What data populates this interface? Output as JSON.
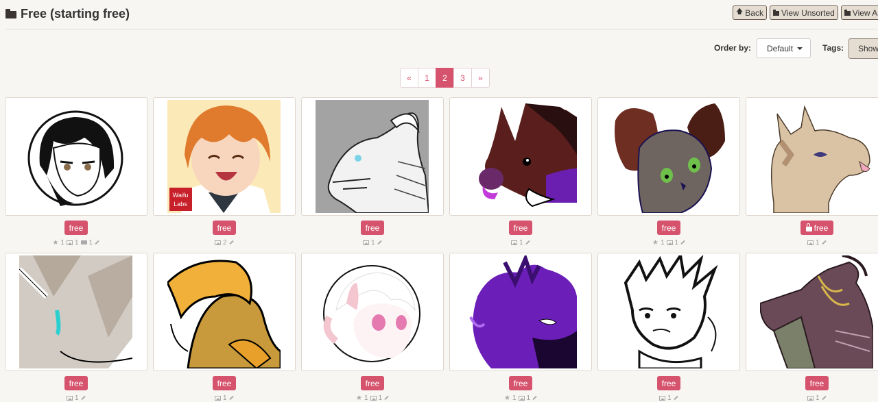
{
  "header": {
    "title": "Free (starting free)",
    "buttons": {
      "back": "Back",
      "view_unsorted": "View Unsorted",
      "view_all": "View A"
    }
  },
  "controls": {
    "order_label": "Order by:",
    "order_value": "Default",
    "tags_label": "Tags:",
    "show_label": "Show"
  },
  "pagination": {
    "prev": "«",
    "pages": [
      "1",
      "2",
      "3"
    ],
    "active": "2",
    "next": "»"
  },
  "cards": [
    {
      "tag": "free",
      "locked": false,
      "stats": [
        {
          "icon": "star-icon",
          "count": "1"
        },
        {
          "icon": "image-icon",
          "count": "1"
        },
        {
          "icon": "comment-icon",
          "count": "1"
        }
      ]
    },
    {
      "tag": "free",
      "locked": false,
      "stats": [
        {
          "icon": "image-icon",
          "count": "2"
        }
      ]
    },
    {
      "tag": "free",
      "locked": false,
      "stats": [
        {
          "icon": "image-icon",
          "count": "1"
        }
      ]
    },
    {
      "tag": "free",
      "locked": false,
      "stats": [
        {
          "icon": "image-icon",
          "count": "1"
        }
      ]
    },
    {
      "tag": "free",
      "locked": false,
      "stats": [
        {
          "icon": "star-icon",
          "count": "1"
        },
        {
          "icon": "image-icon",
          "count": "1"
        }
      ]
    },
    {
      "tag": "free",
      "locked": true,
      "stats": [
        {
          "icon": "image-icon",
          "count": "1"
        }
      ]
    },
    {
      "tag": "free",
      "locked": false,
      "stats": [
        {
          "icon": "image-icon",
          "count": "1"
        }
      ]
    },
    {
      "tag": "free",
      "locked": false,
      "stats": [
        {
          "icon": "image-icon",
          "count": "1"
        }
      ]
    },
    {
      "tag": "free",
      "locked": false,
      "stats": [
        {
          "icon": "star-icon",
          "count": "1"
        },
        {
          "icon": "image-icon",
          "count": "1"
        }
      ]
    },
    {
      "tag": "free",
      "locked": false,
      "stats": [
        {
          "icon": "star-icon",
          "count": "1"
        },
        {
          "icon": "image-icon",
          "count": "1"
        }
      ]
    },
    {
      "tag": "free",
      "locked": false,
      "stats": [
        {
          "icon": "image-icon",
          "count": "1"
        }
      ]
    },
    {
      "tag": "free",
      "locked": false,
      "stats": [
        {
          "icon": "image-icon",
          "count": "1"
        }
      ]
    }
  ],
  "thumb_art": [
    {
      "kind": "avatar-circle",
      "bg": "#ffffff",
      "accent": "#111111"
    },
    {
      "kind": "anime-boy",
      "bg": "#fbe9b7",
      "accent": "#e07a2c",
      "logo": "Waifu Labs"
    },
    {
      "kind": "dragon-sketch",
      "bg": "#a3a3a3",
      "accent": "#f2f2f2"
    },
    {
      "kind": "boar",
      "bg": "#ffffff",
      "accent": "#5a1f1c"
    },
    {
      "kind": "bat-cat",
      "bg": "#ffffff",
      "accent": "#6e6460"
    },
    {
      "kind": "llama",
      "bg": "#ffffff",
      "accent": "#d9c3a4"
    },
    {
      "kind": "unicorn",
      "bg": "#ffffff",
      "accent": "#d2cbc4"
    },
    {
      "kind": "pony",
      "bg": "#ffffff",
      "accent": "#c99a3b"
    },
    {
      "kind": "pink-pony",
      "bg": "#ffffff",
      "accent": "#f4c7d0"
    },
    {
      "kind": "purple-beast",
      "bg": "#ffffff",
      "accent": "#6b1fb8"
    },
    {
      "kind": "ink-elf",
      "bg": "#ffffff",
      "accent": "#111111"
    },
    {
      "kind": "dragon-dark",
      "bg": "#ffffff",
      "accent": "#6a4a57"
    }
  ],
  "colors": {
    "accent": "#d6536d",
    "page_bg": "#f8f6f3",
    "button_bg": "#e6ddd2"
  }
}
